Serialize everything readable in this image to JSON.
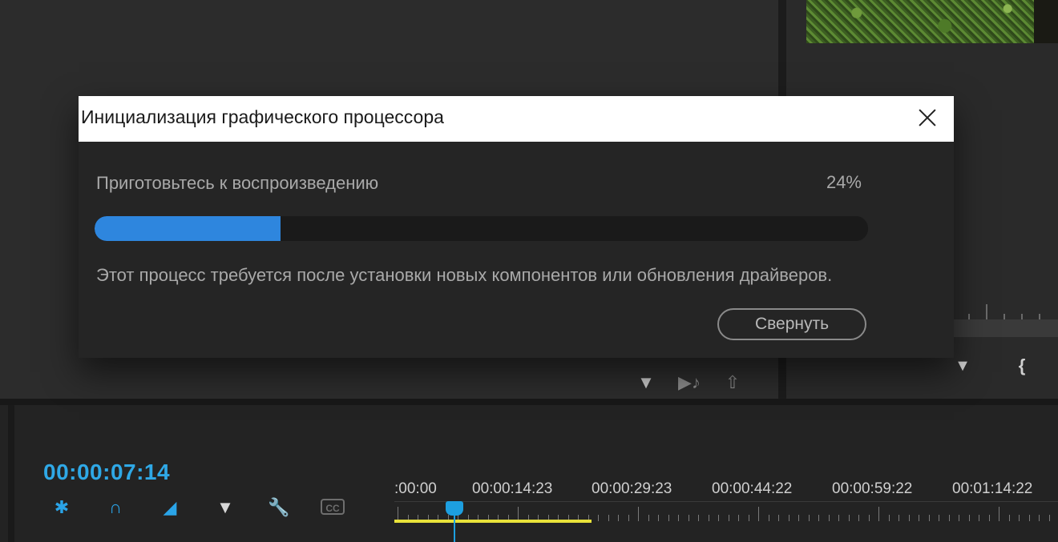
{
  "dialog": {
    "title": "Инициализация графического процессора",
    "close_icon": "close-icon",
    "status_text": "Приготовьтесь к воспроизведению",
    "progress_text": "24%",
    "progress_value": 0.24,
    "info_text": "Этот процесс требуется после установки новых компонентов или обновления драйверов.",
    "collapse_label": "Свернуть"
  },
  "source_toolbar": {
    "icons": [
      "filter-icon",
      "insert-audio-icon",
      "export-icon"
    ]
  },
  "timeline": {
    "timecode": "00:00:07:14",
    "tools": [
      "snap-ripple-icon",
      "magnet-snap-icon",
      "linked-selection-icon",
      "add-marker-icon",
      "wrench-settings-icon",
      "captions-icon"
    ],
    "captions_label": "CC",
    "time_labels": [
      ":00:00",
      "00:00:14:23",
      "00:00:29:23",
      "00:00:44:22",
      "00:00:59:22",
      "00:01:14:22"
    ]
  },
  "colors": {
    "accent_blue": "#2fa8e6",
    "progress_fill": "#2e86de",
    "work_area": "#e8e23a"
  }
}
